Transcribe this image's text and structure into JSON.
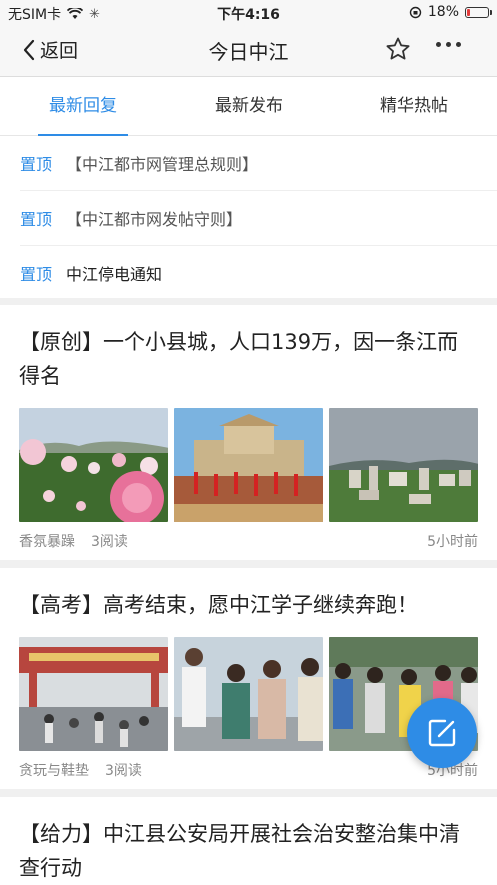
{
  "status_bar": {
    "carrier": "无SIM卡",
    "time": "下午4:16",
    "battery": "18%",
    "battery_level": 0.18
  },
  "nav": {
    "back_label": "返回",
    "title": "今日中江"
  },
  "tabs": [
    {
      "label": "最新回复",
      "active": true
    },
    {
      "label": "最新发布",
      "active": false
    },
    {
      "label": "精华热帖",
      "active": false
    }
  ],
  "pinned": [
    {
      "tag": "置顶",
      "title": "【中江都市网管理总规则】"
    },
    {
      "tag": "置顶",
      "title": "【中江都市网发帖守则】"
    },
    {
      "tag": "置顶",
      "title": "中江停电通知"
    }
  ],
  "posts": [
    {
      "title": "【原创】一个小县城，人口139万，因一条江而得名",
      "author": "香氛暴躁",
      "reads": "3阅读",
      "time": "5小时前"
    },
    {
      "title": "【高考】高考结束，愿中江学子继续奔跑！",
      "author": "贪玩与鞋垫",
      "reads": "3阅读",
      "time": "5小时前"
    },
    {
      "title": "【给力】中江县公安局开展社会治安整治集中清查行动"
    }
  ],
  "colors": {
    "accent": "#2e8ce6",
    "battery_low": "#e23b3b"
  }
}
